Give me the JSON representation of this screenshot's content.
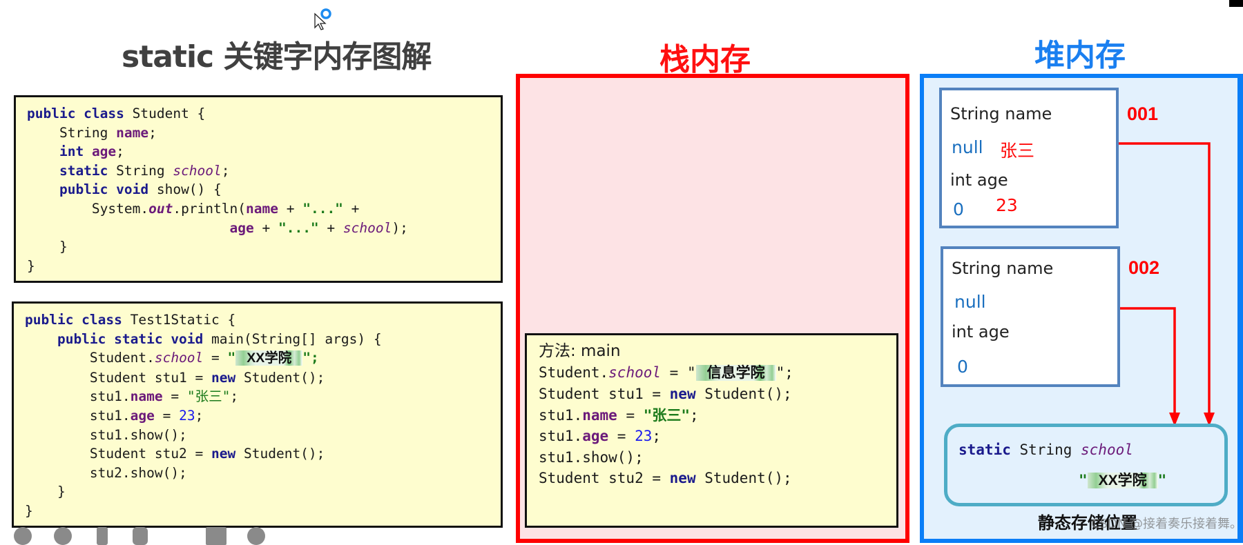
{
  "title": "static 关键字内存图解",
  "stack": {
    "title": "栈内存",
    "frame": {
      "method_label": "方法: main",
      "lines": [
        {
          "prefix": "Student.",
          "field": "school",
          "mid": " = \"",
          "blurred": "信息学院",
          "suffix": "\";"
        },
        {
          "text_a": "Student stu1 = ",
          "kw": "new",
          "text_b": " Student();"
        },
        {
          "prefix": "stu1.",
          "field": "name",
          "mid": " = ",
          "str": "\"张三\"",
          "suffix": ";"
        },
        {
          "prefix": "stu1.",
          "field": "age",
          "mid": " = ",
          "num": "23",
          "suffix": ";"
        },
        {
          "text": "stu1.show();"
        },
        {
          "text_a": "Student stu2 = ",
          "kw": "new",
          "text_b": " Student();"
        }
      ]
    }
  },
  "heap": {
    "title": "堆内存",
    "objects": [
      {
        "address": "001",
        "name_label": "String name",
        "name_default": "null",
        "name_value": "张三",
        "age_label": "int age",
        "age_default": "0",
        "age_value": "23"
      },
      {
        "address": "002",
        "name_label": "String name",
        "name_default": "null",
        "name_value": "",
        "age_label": "int age",
        "age_default": "0",
        "age_value": ""
      }
    ],
    "static_area": {
      "kw": "static",
      "type": " String ",
      "field": "school",
      "value_open": "\"",
      "value_blurred": "XX学院",
      "value_close": "\"",
      "label": "静态存储位置"
    }
  },
  "code": {
    "student_class": {
      "l1_kw": "public class",
      "l1_rest": " Student {",
      "l2_type": "    String ",
      "l2_field": "name",
      "l2_end": ";",
      "l3_kw": "    int",
      "l3_sp": " ",
      "l3_field": "age",
      "l3_end": ";",
      "l4_kw": "    static",
      "l4_type": " String ",
      "l4_field": "school",
      "l4_end": ";",
      "l5_kw": "    public void",
      "l5_rest": " show() {",
      "l6_a": "        System.",
      "l6_out": "out",
      "l6_b": ".println(",
      "l6_name": "name",
      "l6_c": " + ",
      "l6_str": "\"...\"",
      "l6_d": " +",
      "l7_pad": "                         ",
      "l7_age": "age",
      "l7_a": " + ",
      "l7_str": "\"...\"",
      "l7_b": " + ",
      "l7_school": "school",
      "l7_end": ");",
      "l8": "    }",
      "l9": "}"
    },
    "test_class": {
      "l1_kw": "public class",
      "l1_rest": " Test1Static {",
      "l2_kw": "    public static void",
      "l2_rest": " main(String[] args) {",
      "l3_a": "        Student.",
      "l3_field": "school",
      "l3_b": " = ",
      "l3_open": "\"",
      "l3_blur": "XX学院",
      "l3_close": "\";",
      "l4_a": "        Student stu1 = ",
      "l4_kw": "new",
      "l4_b": " Student();",
      "l5_a": "        stu1.",
      "l5_field": "name",
      "l5_b": " = ",
      "l5_str": "\"张三\"",
      "l5_end": ";",
      "l6_a": "        stu1.",
      "l6_field": "age",
      "l6_b": " = ",
      "l6_num": "23",
      "l6_end": ";",
      "l7": "        stu1.show();",
      "l8_a": "        Student stu2 = ",
      "l8_kw": "new",
      "l8_b": " Student();",
      "l9": "        stu2.show();",
      "l10": "    }",
      "l11": "}"
    }
  },
  "watermark": "CSDN @接着奏乐接着舞。",
  "colors": {
    "stack_border": "#ff0000",
    "stack_bg": "#fde3e5",
    "heap_border": "#0a7ef7",
    "heap_bg": "#e3f1fd",
    "code_bg": "#fefdcf",
    "arrow": "#ff0000"
  }
}
